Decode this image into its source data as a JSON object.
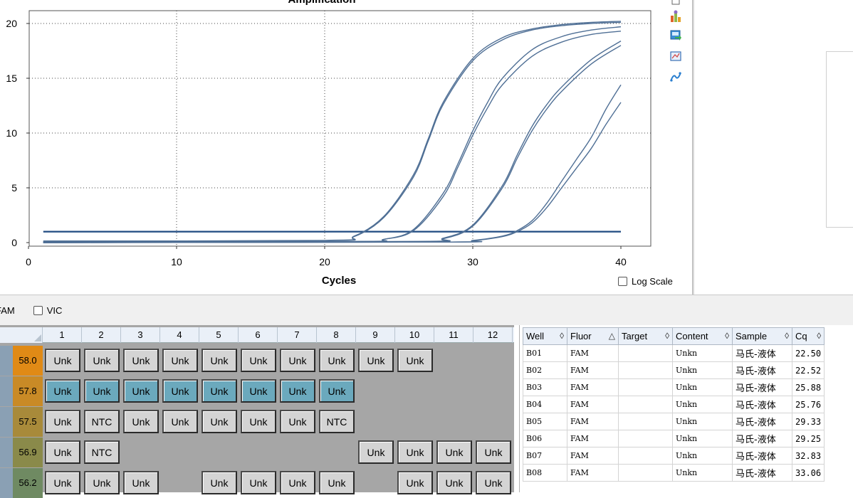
{
  "chart": {
    "title": "Amplification",
    "xlabel": "Cycles",
    "y_ticks": [
      "0",
      "5",
      "10",
      "15",
      "20"
    ],
    "x_ticks": [
      "0",
      "10",
      "20",
      "30",
      "40"
    ],
    "log_scale_label": "Log Scale"
  },
  "chart_data": {
    "type": "line",
    "title": "Amplification",
    "xlabel": "Cycles",
    "ylabel": "",
    "xlim": [
      0,
      42
    ],
    "ylim": [
      -0.4,
      21
    ],
    "grid": true,
    "threshold": 1.0,
    "series": [
      {
        "x": [
          1,
          20,
          22,
          24,
          26,
          27,
          28,
          30,
          32,
          34,
          36,
          38,
          40
        ],
        "values": [
          0.15,
          0.2,
          0.6,
          2.4,
          6.2,
          9.5,
          12.8,
          16.8,
          18.7,
          19.5,
          19.9,
          20.1,
          20.2
        ]
      },
      {
        "x": [
          1,
          20,
          22,
          24,
          26,
          27,
          28,
          30,
          32,
          34,
          36,
          38,
          40
        ],
        "values": [
          0.1,
          0.18,
          0.55,
          2.3,
          6.0,
          9.3,
          12.6,
          16.6,
          18.5,
          19.4,
          19.8,
          20.0,
          20.1
        ]
      },
      {
        "x": [
          1,
          22,
          24,
          26,
          28,
          29,
          30,
          31,
          32,
          34,
          36,
          38,
          40
        ],
        "values": [
          0.05,
          0.1,
          0.3,
          1.2,
          4.5,
          7.2,
          10.2,
          12.8,
          15.0,
          17.6,
          18.8,
          19.4,
          19.7
        ]
      },
      {
        "x": [
          1,
          22,
          24,
          26,
          28,
          29,
          30,
          31,
          32,
          34,
          36,
          38,
          40
        ],
        "values": [
          0.05,
          0.1,
          0.3,
          1.1,
          4.2,
          6.9,
          9.8,
          12.3,
          14.4,
          17.0,
          18.3,
          19.0,
          19.3
        ]
      },
      {
        "x": [
          1,
          26,
          28,
          30,
          32,
          33,
          34,
          35,
          36,
          38,
          40
        ],
        "values": [
          0.0,
          0.1,
          0.4,
          1.6,
          5.2,
          8.0,
          10.6,
          12.6,
          14.2,
          16.7,
          18.4
        ]
      },
      {
        "x": [
          1,
          26,
          28,
          30,
          32,
          33,
          34,
          35,
          36,
          38,
          40
        ],
        "values": [
          0.0,
          0.1,
          0.35,
          1.5,
          5.0,
          7.7,
          10.2,
          12.2,
          13.8,
          16.3,
          18.0
        ]
      },
      {
        "x": [
          1,
          28,
          30,
          32,
          33,
          34,
          35,
          36,
          37,
          38,
          39,
          40
        ],
        "values": [
          0.0,
          0.05,
          0.2,
          0.6,
          1.1,
          2.0,
          3.6,
          5.6,
          7.6,
          9.6,
          12.2,
          14.4
        ]
      },
      {
        "x": [
          1,
          28,
          30,
          32,
          33,
          34,
          35,
          36,
          37,
          38,
          39,
          40
        ],
        "values": [
          0.0,
          0.05,
          0.18,
          0.55,
          1.0,
          1.8,
          3.2,
          5.0,
          6.8,
          8.6,
          10.8,
          12.8
        ]
      }
    ]
  },
  "fluor_bar": {
    "fam_label": "FAM",
    "vic_label": "VIC"
  },
  "plate": {
    "columns": [
      "1",
      "2",
      "3",
      "4",
      "5",
      "6",
      "7",
      "8",
      "9",
      "10",
      "11",
      "12"
    ],
    "rows": [
      {
        "temp": "58.0",
        "temp_color": "#e08a16",
        "cells": [
          [
            "Unk",
            "gray"
          ],
          [
            "Unk",
            "gray"
          ],
          [
            "Unk",
            "gray"
          ],
          [
            "Unk",
            "gray"
          ],
          [
            "Unk",
            "gray"
          ],
          [
            "Unk",
            "gray"
          ],
          [
            "Unk",
            "gray"
          ],
          [
            "Unk",
            "gray"
          ],
          [
            "Unk",
            "gray"
          ],
          [
            "Unk",
            "gray"
          ],
          [
            "",
            ""
          ],
          [
            "",
            ""
          ]
        ]
      },
      {
        "temp": "57.8",
        "temp_color": "#c98a26",
        "cells": [
          [
            "Unk",
            "teal"
          ],
          [
            "Unk",
            "teal"
          ],
          [
            "Unk",
            "teal"
          ],
          [
            "Unk",
            "teal"
          ],
          [
            "Unk",
            "teal"
          ],
          [
            "Unk",
            "teal"
          ],
          [
            "Unk",
            "teal"
          ],
          [
            "Unk",
            "teal"
          ],
          [
            "",
            ""
          ],
          [
            "",
            ""
          ],
          [
            "",
            ""
          ],
          [
            "",
            ""
          ]
        ]
      },
      {
        "temp": "57.5",
        "temp_color": "#a88a3a",
        "cells": [
          [
            "Unk",
            "gray"
          ],
          [
            "NTC",
            "gray"
          ],
          [
            "Unk",
            "gray"
          ],
          [
            "Unk",
            "gray"
          ],
          [
            "Unk",
            "gray"
          ],
          [
            "Unk",
            "gray"
          ],
          [
            "Unk",
            "gray"
          ],
          [
            "NTC",
            "gray"
          ],
          [
            "",
            ""
          ],
          [
            "",
            ""
          ],
          [
            "",
            ""
          ],
          [
            "",
            ""
          ]
        ]
      },
      {
        "temp": "56.9",
        "temp_color": "#8a8a4a",
        "cells": [
          [
            "Unk",
            "gray"
          ],
          [
            "NTC",
            "gray"
          ],
          [
            "",
            ""
          ],
          [
            "",
            ""
          ],
          [
            "",
            ""
          ],
          [
            "",
            ""
          ],
          [
            "",
            ""
          ],
          [
            "",
            ""
          ],
          [
            "Unk",
            "gray"
          ],
          [
            "Unk",
            "gray"
          ],
          [
            "Unk",
            "gray"
          ],
          [
            "Unk",
            "gray"
          ]
        ]
      },
      {
        "temp": "56.2",
        "temp_color": "#6f8a62",
        "cells": [
          [
            "Unk",
            "gray"
          ],
          [
            "Unk",
            "gray"
          ],
          [
            "Unk",
            "gray"
          ],
          [
            "",
            ""
          ],
          [
            "Unk",
            "gray"
          ],
          [
            "Unk",
            "gray"
          ],
          [
            "Unk",
            "gray"
          ],
          [
            "Unk",
            "gray"
          ],
          [
            "",
            ""
          ],
          [
            "Unk",
            "gray"
          ],
          [
            "Unk",
            "gray"
          ],
          [
            "Unk",
            "gray"
          ]
        ]
      }
    ]
  },
  "table": {
    "headers": [
      {
        "label": "Well",
        "sort": "◊"
      },
      {
        "label": "Fluor",
        "sort": "△"
      },
      {
        "label": "Target",
        "sort": "◊"
      },
      {
        "label": "Content",
        "sort": "◊"
      },
      {
        "label": "Sample",
        "sort": "◊"
      },
      {
        "label": "Cq",
        "sort": "◊"
      }
    ],
    "rows": [
      [
        "B01",
        "FAM",
        "",
        "Unkn",
        "马氏-液体",
        "22.50"
      ],
      [
        "B02",
        "FAM",
        "",
        "Unkn",
        "马氏-液体",
        "22.52"
      ],
      [
        "B03",
        "FAM",
        "",
        "Unkn",
        "马氏-液体",
        "25.88"
      ],
      [
        "B04",
        "FAM",
        "",
        "Unkn",
        "马氏-液体",
        "25.76"
      ],
      [
        "B05",
        "FAM",
        "",
        "Unkn",
        "马氏-液体",
        "29.33"
      ],
      [
        "B06",
        "FAM",
        "",
        "Unkn",
        "马氏-液体",
        "29.25"
      ],
      [
        "B07",
        "FAM",
        "",
        "Unkn",
        "马氏-液体",
        "32.83"
      ],
      [
        "B08",
        "FAM",
        "",
        "Unkn",
        "马氏-液体",
        "33.06"
      ]
    ]
  },
  "colors": {
    "curve": "#4f6f95",
    "threshold": "#1f4a80",
    "teal_well": "#6ba9bd",
    "gray_well": "#d4d4d4"
  },
  "icons": [
    "copy-icon",
    "chart-settings-icon",
    "export-icon",
    "image-icon",
    "curve-fit-icon"
  ]
}
